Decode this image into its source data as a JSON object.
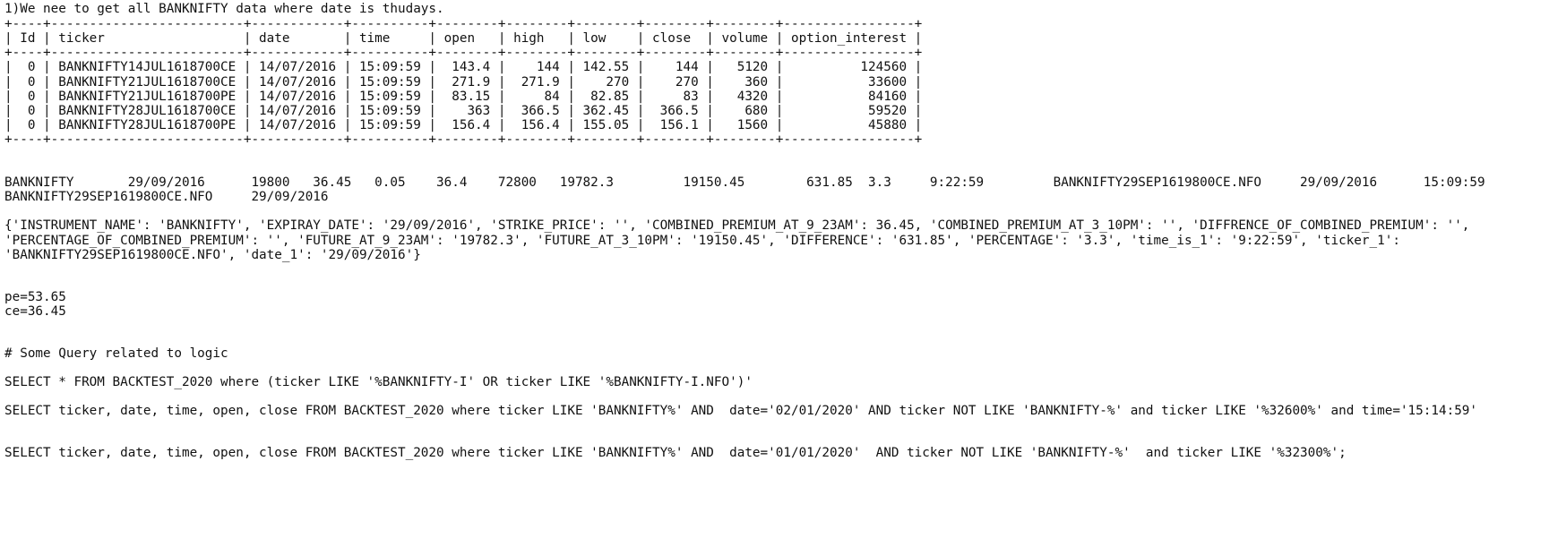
{
  "document": {
    "heading": "1)We nee to get all BANKNIFTY data where date is thudays.",
    "table": {
      "border": "+----+-------------------------+------------+----------+--------+--------+--------+--------+--------+-----------------+",
      "header": "| Id | ticker                  | date       | time     | open   | high   | low    | close  | volume | option_interest |",
      "rows": [
        "|  0 | BANKNIFTY14JUL1618700CE | 14/07/2016 | 15:09:59 |  143.4 |    144 | 142.55 |    144 |   5120 |          124560 |",
        "|  0 | BANKNIFTY21JUL1618700CE | 14/07/2016 | 15:09:59 |  271.9 |  271.9 |    270 |    270 |    360 |           33600 |",
        "|  0 | BANKNIFTY21JUL1618700PE | 14/07/2016 | 15:09:59 |  83.15 |     84 |  82.85 |     83 |   4320 |           84160 |",
        "|  0 | BANKNIFTY28JUL1618700CE | 14/07/2016 | 15:09:59 |    363 |  366.5 | 362.45 |  366.5 |    680 |           59520 |",
        "|  0 | BANKNIFTY28JUL1618700PE | 14/07/2016 | 15:09:59 |  156.4 |  156.4 | 155.05 |  156.1 |   1560 |           45880 |"
      ]
    },
    "tab_line_1": "BANKNIFTY       29/09/2016      19800   36.45   0.05    36.4    72800   19782.3         19150.45        631.85  3.3     9:22:59         BANKNIFTY29SEP1619800CE.NFO     29/09/2016      15:09:59",
    "tab_line_2": "BANKNIFTY29SEP1619800CE.NFO     29/09/2016",
    "dict_lines": [
      "{'INSTRUMENT_NAME': 'BANKNIFTY', 'EXPIRAY_DATE': '29/09/2016', 'STRIKE_PRICE': '', 'COMBINED_PREMIUM_AT_9_23AM': 36.45, 'COMBINED_PREMIUM_AT_3_10PM': '', 'DIFFRENCE_OF_COMBINED_PREMIUM': '',",
      "'PERCENTAGE_OF_COMBINED_PREMIUM': '', 'FUTURE_AT_9_23AM': '19782.3', 'FUTURE_AT_3_10PM': '19150.45', 'DIFFERENCE': '631.85', 'PERCENTAGE': '3.3', 'time_is_1': '9:22:59', 'ticker_1':",
      "'BANKNIFTY29SEP1619800CE.NFO', 'date_1': '29/09/2016'}"
    ],
    "pe_line": "pe=53.65",
    "ce_line": "ce=36.45",
    "comment": "# Some Query related to logic",
    "queries": [
      "SELECT * FROM BACKTEST_2020 where (ticker LIKE '%BANKNIFTY-I' OR ticker LIKE '%BANKNIFTY-I.NFO')'",
      "SELECT ticker, date, time, open, close FROM BACKTEST_2020 where ticker LIKE 'BANKNIFTY%' AND  date='02/01/2020' AND ticker NOT LIKE 'BANKNIFTY-%' and ticker LIKE '%32600%' and time='15:14:59'",
      "SELECT ticker, date, time, open, close FROM BACKTEST_2020 where ticker LIKE 'BANKNIFTY%' AND  date='01/01/2020'  AND ticker NOT LIKE 'BANKNIFTY-%'  and ticker LIKE '%32300%';"
    ]
  }
}
